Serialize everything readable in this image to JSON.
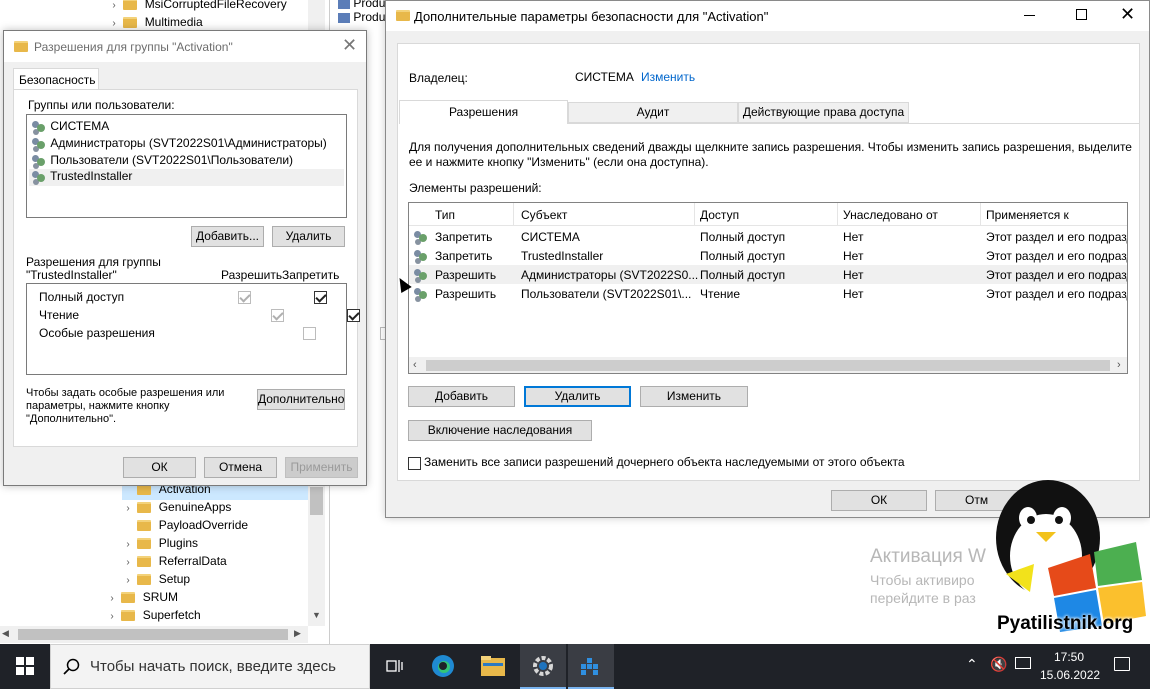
{
  "background_top": [
    "Produ",
    "Produ"
  ],
  "regedit": {
    "top_items": [
      {
        "label": "MsiCorruptedFileRecovery"
      },
      {
        "label": "Multimedia"
      }
    ],
    "tree": [
      {
        "label": "Activation",
        "selected": true
      },
      {
        "label": "GenuineApps"
      },
      {
        "label": "PayloadOverride"
      },
      {
        "label": "Plugins"
      },
      {
        "label": "ReferralData"
      },
      {
        "label": "Setup"
      },
      {
        "label": "SRUM"
      },
      {
        "label": "Superfetch"
      }
    ]
  },
  "perm_dialog": {
    "title": "Разрешения для группы \"Activation\"",
    "tab": "Безопасность",
    "groups_label": "Группы или пользователи:",
    "users": [
      "СИСТЕМА",
      "Администраторы (SVT2022S01\\Администраторы)",
      "Пользователи (SVT2022S01\\Пользователи)",
      "TrustedInstaller"
    ],
    "add_btn": "Добавить...",
    "remove_btn": "Удалить",
    "perm_for_line1": "Разрешения для группы",
    "perm_for_line2": "\"TrustedInstaller\"",
    "allow_col": "Разрешить",
    "deny_col": "Запретить",
    "perms": [
      {
        "name": "Полный доступ",
        "allow": true,
        "deny": true
      },
      {
        "name": "Чтение",
        "allow": true,
        "deny": true
      },
      {
        "name": "Особые разрешения",
        "allow": false,
        "deny": false
      }
    ],
    "special_line1": "Чтобы задать особые разрешения или",
    "special_line2": "параметры, нажмите кнопку",
    "special_line3": "\"Дополнительно\".",
    "advanced_btn": "Дополнительно",
    "ok": "ОК",
    "cancel": "Отмена",
    "apply": "Применить"
  },
  "adv_dialog": {
    "title": "Дополнительные параметры безопасности  для \"Activation\"",
    "owner_label": "Владелец:",
    "owner_value": "СИСТЕМА",
    "owner_change": "Изменить",
    "tabs": [
      "Разрешения",
      "Аудит",
      "Действующие права доступа"
    ],
    "info_line1": "Для получения дополнительных сведений дважды щелкните запись разрешения. Чтобы изменить запись разрешения, выделите",
    "info_line2": "ее и нажмите кнопку \"Изменить\" (если она доступна).",
    "entries_label": "Элементы разрешений:",
    "columns": [
      "Тип",
      "Субъект",
      "Доступ",
      "Унаследовано от",
      "Применяется к"
    ],
    "rows": [
      {
        "type": "Запретить",
        "subject": "СИСТЕМА",
        "access": "Полный доступ",
        "inherited": "Нет",
        "applies": "Этот раздел и его подразд"
      },
      {
        "type": "Запретить",
        "subject": "TrustedInstaller",
        "access": "Полный доступ",
        "inherited": "Нет",
        "applies": "Этот раздел и его подразд"
      },
      {
        "type": "Разрешить",
        "subject": "Администраторы (SVT2022S0...",
        "access": "Полный доступ",
        "inherited": "Нет",
        "applies": "Этот раздел и его подразд"
      },
      {
        "type": "Разрешить",
        "subject": "Пользователи (SVT2022S01\\...",
        "access": "Чтение",
        "inherited": "Нет",
        "applies": "Этот раздел и его подразд"
      }
    ],
    "add": "Добавить",
    "remove": "Удалить",
    "edit": "Изменить",
    "enable_inherit": "Включение наследования",
    "replace_label": "Заменить все записи разрешений дочернего объекта наследуемыми от этого объекта",
    "ok": "ОК",
    "cancel_partial": "Отм"
  },
  "watermark": {
    "line1": "Активация W",
    "line2": "Чтобы активиро",
    "line3": "перейдите в раз"
  },
  "logo_text": "Pyatilistnik.org",
  "taskbar": {
    "search_placeholder": "Чтобы начать поиск, введите здесь",
    "time": "17:50",
    "date": "15.06.2022"
  },
  "colors": {
    "accent": "#0078d7",
    "taskbar": "#1f2228",
    "selection": "#cce8ff"
  }
}
